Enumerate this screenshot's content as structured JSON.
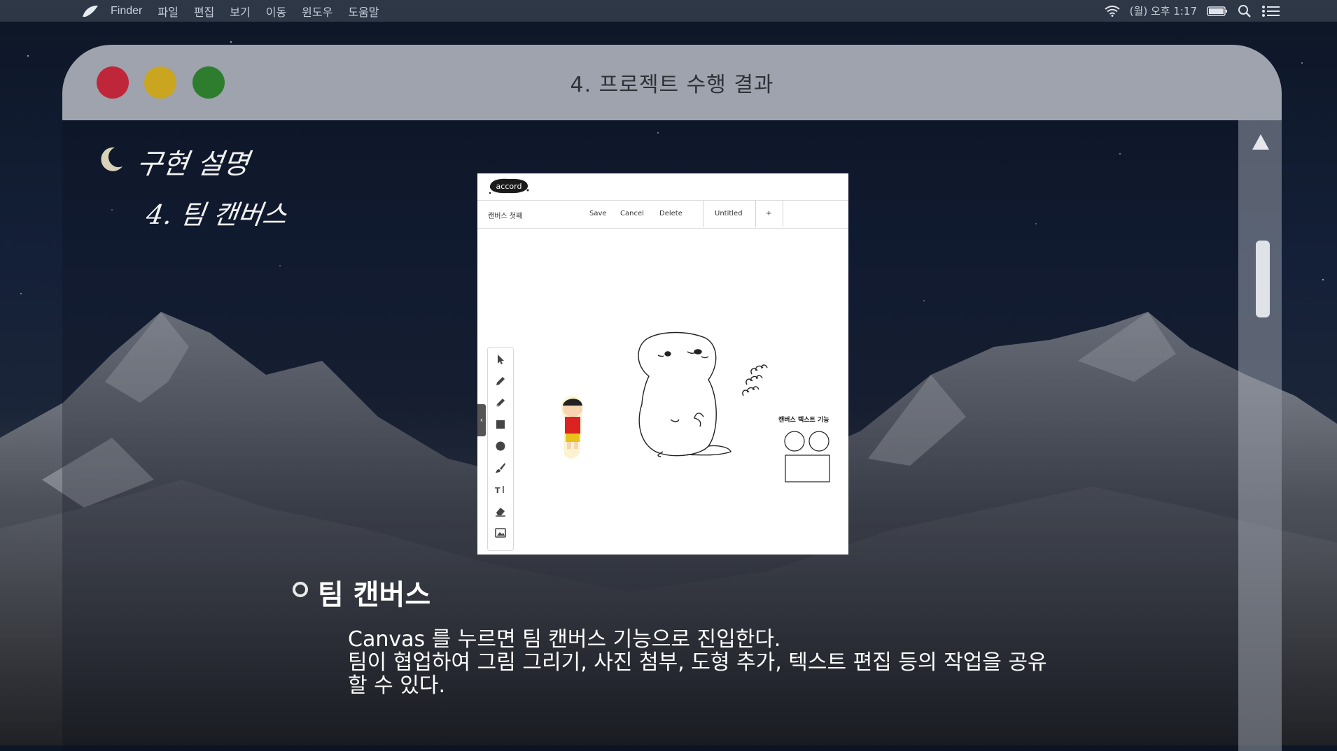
{
  "menubar": {
    "app": "Finder",
    "items": [
      "파일",
      "편집",
      "보기",
      "이동",
      "윈도우",
      "도움말"
    ],
    "clock": "(월) 오후 1:17"
  },
  "window": {
    "title": "4. 프로젝트 수행 결과"
  },
  "heading": {
    "line1": "구현 설명",
    "line2": "4. 팀 캔버스"
  },
  "screenshot": {
    "canvas_name": "캔버스 첫째",
    "save": "Save",
    "cancel": "Cancel",
    "delete": "Delete",
    "tab": "Untitled",
    "add_tab": "+",
    "logo": "accord",
    "canvas_text": "캔버스 텍스트 기능",
    "tools": [
      "select-icon",
      "pencil-icon",
      "pen-icon",
      "rectangle-icon",
      "circle-icon",
      "brush-icon",
      "text-icon",
      "eraser-icon",
      "image-icon"
    ]
  },
  "section": {
    "title": "팀 캔버스",
    "lines": [
      "Canvas 를 누르면 팀 캔버스 기능으로 진입한다.",
      "팀이 협업하여 그림 그리기, 사진 첨부, 도형 추가, 텍스트 편집 등의 작업을 공유",
      "할 수 있다."
    ]
  },
  "colors": {
    "close": "#c0263a",
    "minimize": "#c9a520",
    "zoom": "#2e7d2e",
    "titlebar": "#9ea3ad"
  }
}
